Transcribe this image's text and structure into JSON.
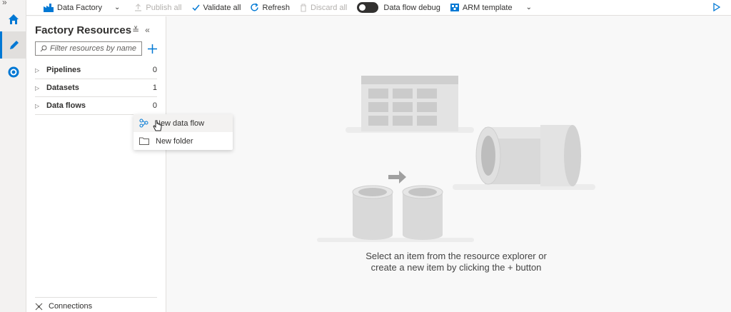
{
  "rail": {
    "items": [
      {
        "icon": "home-icon"
      },
      {
        "icon": "pencil-icon",
        "active": true
      },
      {
        "icon": "monitor-icon"
      }
    ]
  },
  "toolbar": {
    "factory_label": "Data Factory",
    "publish_label": "Publish all",
    "validate_label": "Validate all",
    "refresh_label": "Refresh",
    "discard_label": "Discard all",
    "debug_label": "Data flow debug",
    "arm_label": "ARM template"
  },
  "panel": {
    "title": "Factory Resources",
    "search_placeholder": "Filter resources by name",
    "tree": [
      {
        "label": "Pipelines",
        "count": "0"
      },
      {
        "label": "Datasets",
        "count": "1"
      },
      {
        "label": "Data flows",
        "count": "0"
      }
    ],
    "connections_label": "Connections"
  },
  "context_menu": {
    "items": [
      {
        "label": "New data flow",
        "icon": "data-flow-icon"
      },
      {
        "label": "New folder",
        "icon": "folder-icon"
      }
    ]
  },
  "main": {
    "empty_line1": "Select an item from the resource explorer or",
    "empty_line2": "create a new item by clicking the + button"
  },
  "colors": {
    "accent": "#0078d4",
    "toolbar_bg": "#ffffff",
    "canvas_bg": "#f8f8f8"
  }
}
